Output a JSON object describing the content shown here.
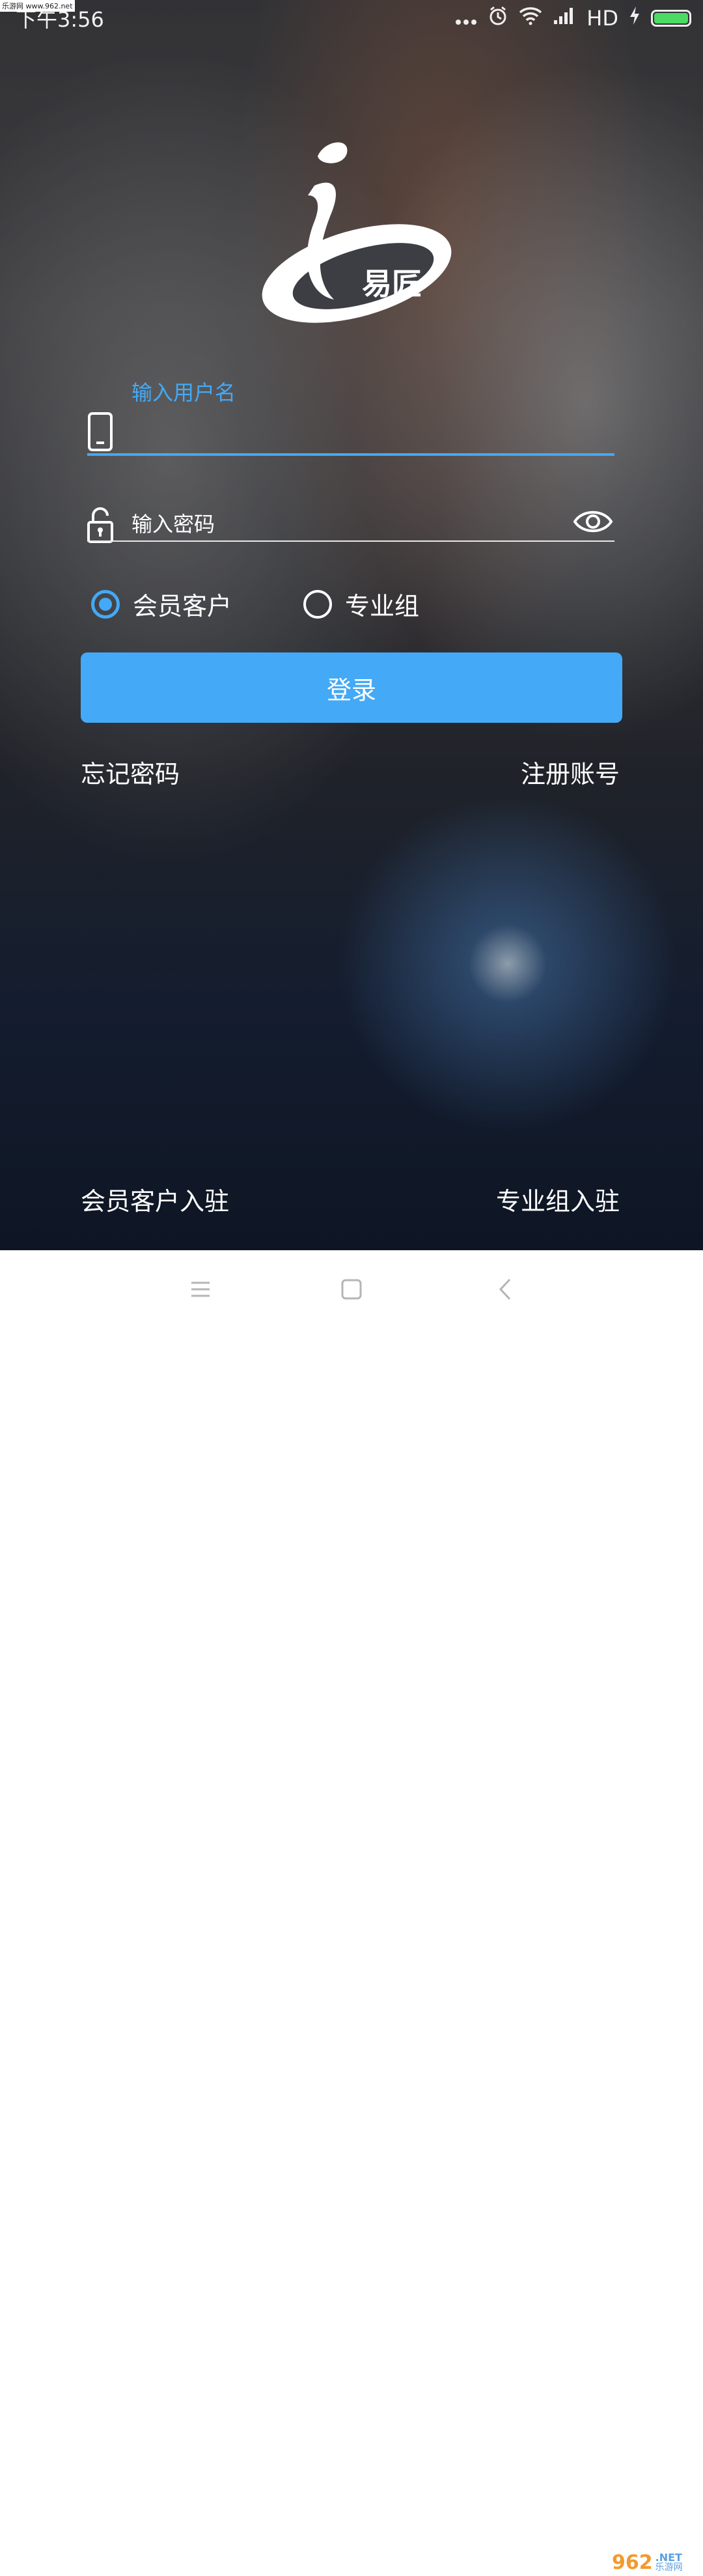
{
  "status_bar": {
    "site_tag": "乐游网 www.962.net",
    "time": "下午3:56",
    "network": "HD"
  },
  "logo": {
    "brand": "易匠"
  },
  "login_form": {
    "username_label": "输入用户名",
    "username_value": "",
    "password_placeholder": "输入密码",
    "roles": [
      {
        "label": "会员客户",
        "checked": true
      },
      {
        "label": "专业组",
        "checked": false
      }
    ],
    "login_label": "登录",
    "forgot_label": "忘记密码",
    "register_label": "注册账号"
  },
  "footer_links": {
    "member_join": "会员客户入驻",
    "pro_join": "专业组入驻"
  },
  "watermark": {
    "number": "962",
    "net": ".NET",
    "cn": "乐游网"
  },
  "colors": {
    "accent": "#44a9f6",
    "battery": "#4cd964",
    "navbar_bg": "#ffffff"
  },
  "icons": [
    "phone-icon",
    "lock-icon",
    "eye-icon",
    "menu-icon",
    "home-icon",
    "back-icon",
    "wifi-icon",
    "alarm-icon",
    "signal-icon",
    "battery-icon",
    "charging-icon",
    "more-icon"
  ]
}
